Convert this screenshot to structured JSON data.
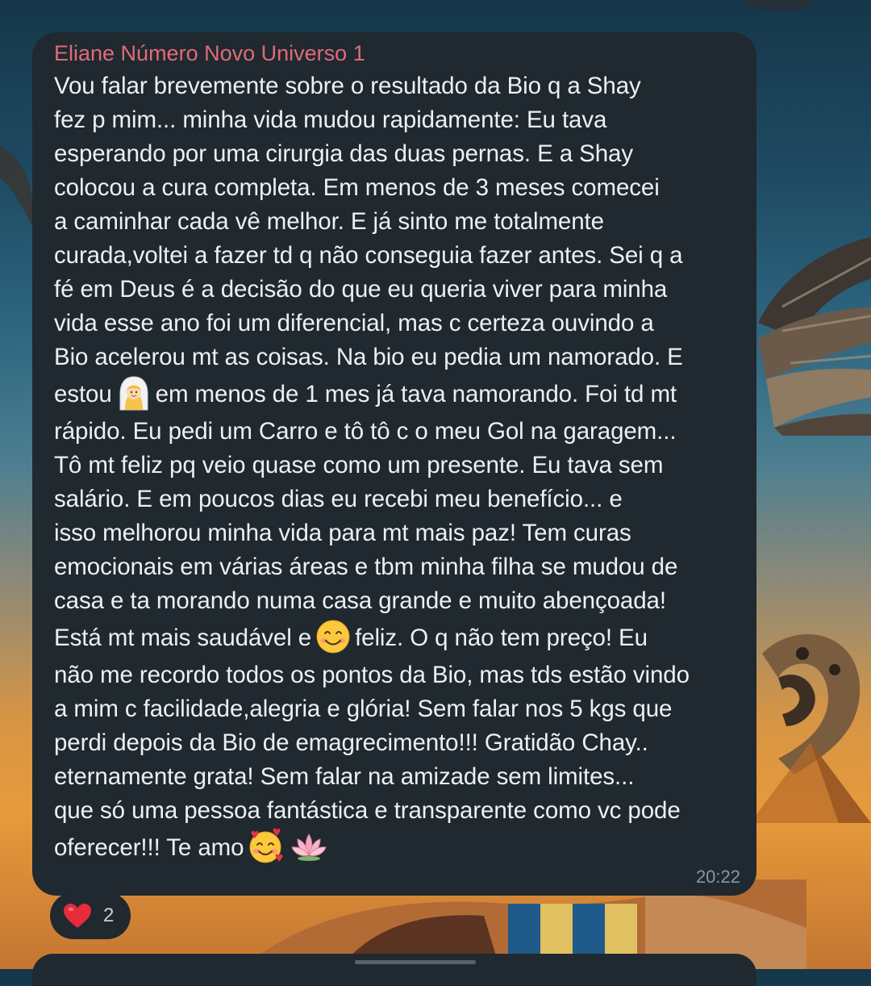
{
  "message": {
    "sender": "Eliane Número Novo Universo 1",
    "lines": [
      "Vou falar brevemente sobre o resultado da Bio q a Shay",
      "fez p mim... minha vida mudou rapidamente: Eu tava",
      "esperando por uma cirurgia das duas pernas. E a Shay",
      "colocou a cura completa. Em menos de 3 meses comecei",
      "a caminhar cada vê melhor. E já sinto me totalmente",
      "curada,voltei a fazer td q não conseguia fazer antes. Sei q a",
      "fé em Deus é a decisão do que eu queria viver para minha",
      "vida esse ano foi um diferencial,  mas c certeza ouvindo a",
      "Bio acelerou mt as coisas. Na bio eu pedia um namorado.  E"
    ],
    "line_emoji_1": {
      "before": "estou",
      "after": "em menos de 1 mes já tava namorando.  Foi td mt",
      "emoji": "woman-with-veil-emoji"
    },
    "lines_2": [
      "rápido. Eu pedi um Carro e tô tô c o meu Gol na garagem...",
      "Tô mt feliz pq veio quase como um presente. Eu tava sem",
      "salário. E em poucos dias eu recebi meu benefício... e",
      "isso melhorou minha vida para mt mais paz! Tem curas",
      "emocionais em várias áreas e tbm minha filha se mudou de",
      "casa e ta morando numa casa grande e muito abençoada!"
    ],
    "line_emoji_2": {
      "before": "Está mt mais saudável e",
      "after": "feliz. O q não tem preço! Eu",
      "emoji": "smiling-face-emoji"
    },
    "lines_3": [
      "não me recordo todos os pontos da Bio, mas tds estão vindo",
      "a mim c facilidade,alegria e glória! Sem falar nos 5 kgs que",
      "perdi depois da Bio de emagrecimento!!! Gratidão Chay..",
      "eternamente grata! Sem falar na amizade sem limites...",
      "que só uma pessoa fantástica e transparente como vc pode"
    ],
    "line_emoji_3": {
      "before": "oferecer!!! Te amo",
      "emojis": [
        "smiling-face-with-hearts-emoji",
        "lotus-emoji"
      ]
    },
    "time": "20:22"
  },
  "reaction": {
    "emoji": "heart-icon",
    "count": "2"
  },
  "colors": {
    "bubble": "#1f292f",
    "sender": "#e16a7a",
    "text": "#eef0f1",
    "timestamp": "#8b979e"
  }
}
